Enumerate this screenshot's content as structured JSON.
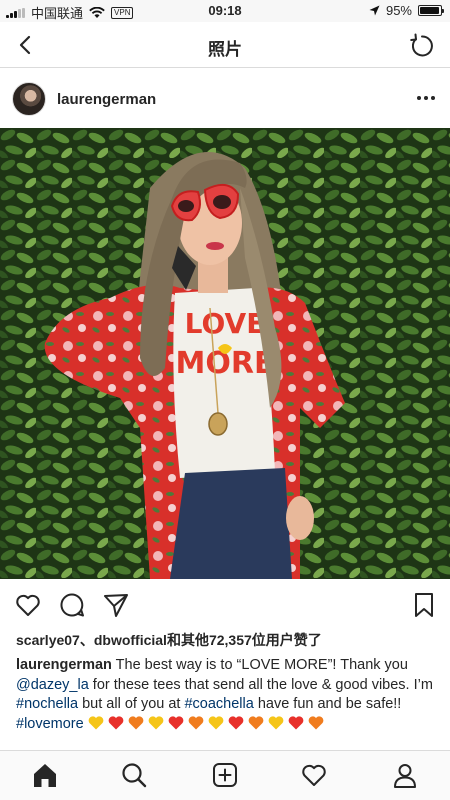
{
  "status_bar": {
    "carrier": "中国联通",
    "vpn": "VPN",
    "time": "09:18",
    "battery": "95%",
    "battery_level": 0.95
  },
  "nav": {
    "title": "照片",
    "back_icon": "chevron-left-icon",
    "refresh_icon": "refresh-icon"
  },
  "post": {
    "username": "laurengerman",
    "more_icon": "more-horizontal-icon",
    "photo_description_icon": "photo",
    "likes": "scarlye07、dbwofficial和其他72,357位用户赞了",
    "caption": {
      "user": "laurengerman",
      "t1": " The best way is to “LOVE MORE”! Thank you ",
      "mention": "@dazey_la",
      "t2": " for these tees that send all the love & good vibes. I’m ",
      "tag1": "#nochella",
      "t3": " but all of you at ",
      "tag2": "#coachella",
      "t4": " have fun and be safe!! ",
      "tag3": "#lovemore",
      "hearts": [
        "#f5c518",
        "#e8302a",
        "#f07c1e",
        "#f5c518",
        "#e8302a",
        "#f07c1e",
        "#f5c518",
        "#e8302a",
        "#f07c1e",
        "#f5c518",
        "#e8302a",
        "#f07c1e"
      ]
    }
  },
  "actions": [
    "heart-icon",
    "comment-icon",
    "share-icon",
    "bookmark-icon"
  ],
  "tabs": [
    "home-icon",
    "search-icon",
    "add-post-icon",
    "activity-heart-icon",
    "profile-icon"
  ]
}
